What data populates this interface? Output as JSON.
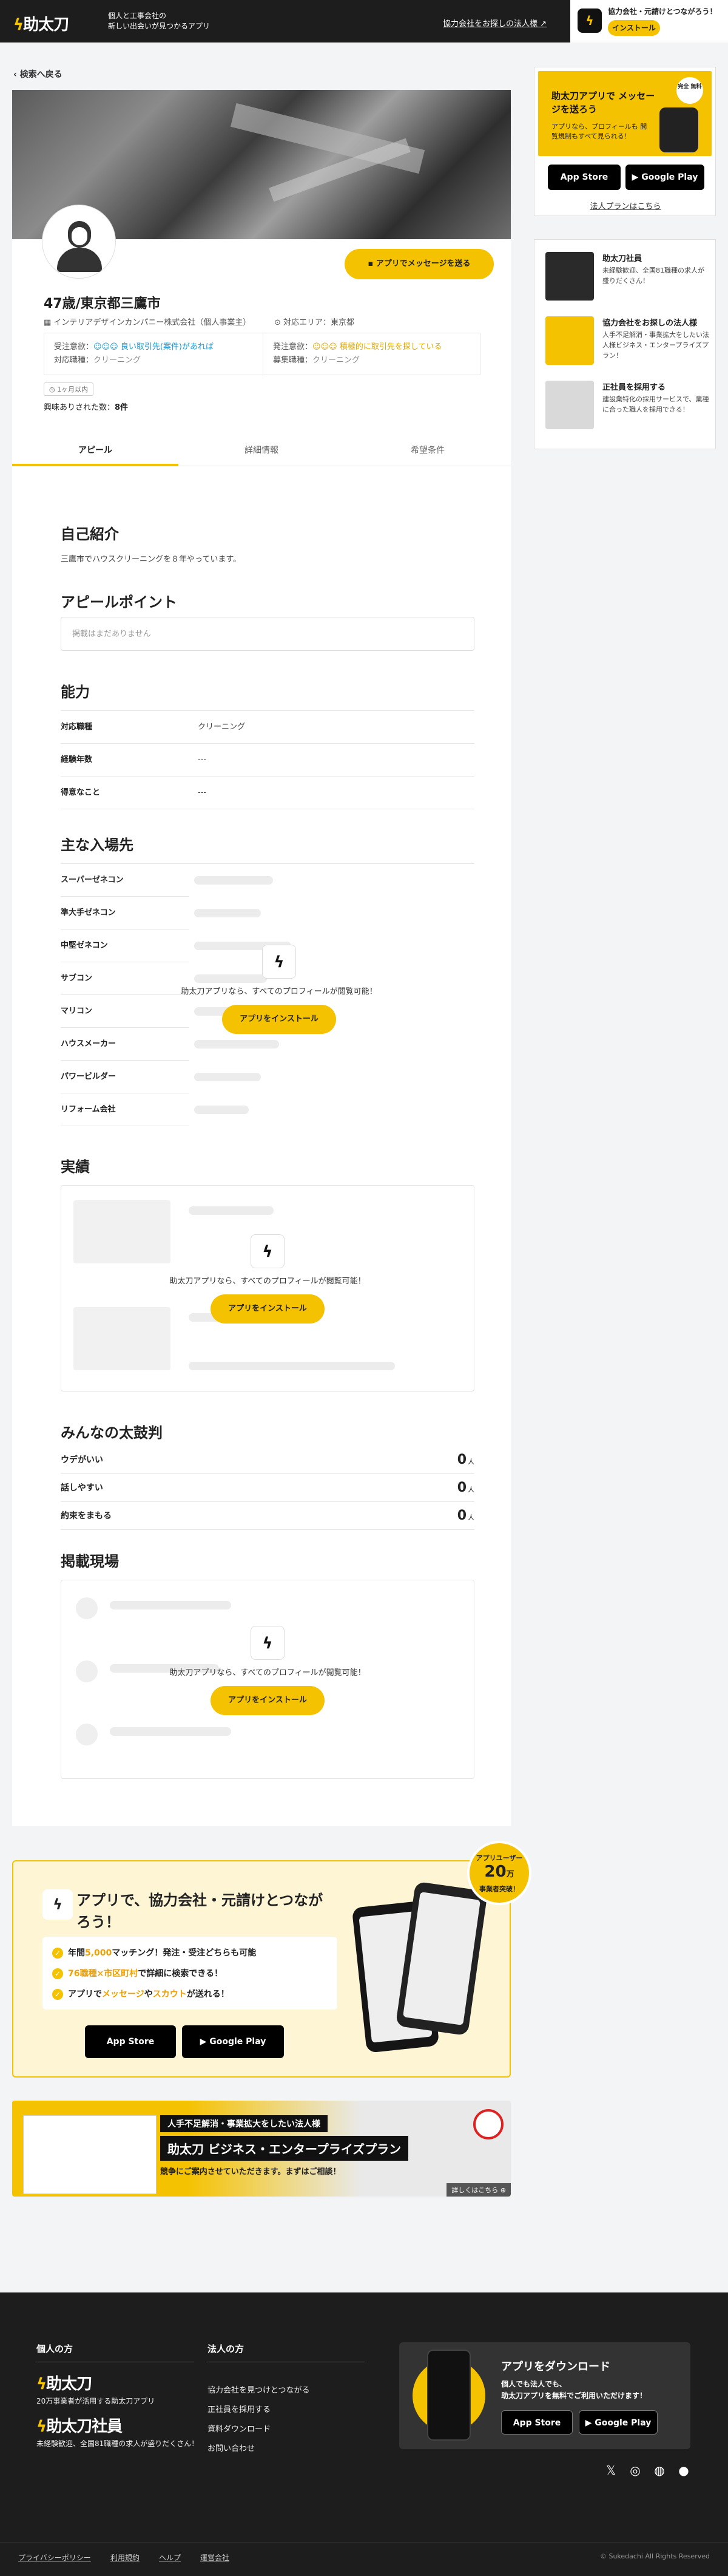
{
  "header": {
    "logo": "助太刀",
    "tagline_1": "個人と工事会社の",
    "tagline_2": "新しい出会いが見つかるアプリ",
    "partner_link": "協力会社をお探しの法人様 ↗",
    "install_title": "協力会社・元請けとつながろう！",
    "install_button": "インストール"
  },
  "back_label": "検索へ戻る",
  "profile": {
    "message_button": "アプリでメッセージを送る",
    "name": "47歳/東京都三鷹市",
    "company": "インテリアデザインカンパニー株式会社（個人事業主）",
    "area": "対応エリア：東京都",
    "order_receive_label": "受注意欲：",
    "order_receive_value": "良い取引先(案件)があれば",
    "job_types_label": "対応職種：",
    "job_types_value": "クリーニング",
    "order_place_label": "発注意欲：",
    "order_place_value": "積極的に取引先を探している",
    "recruit_label": "募集職種：",
    "recruit_value": "クリーニング",
    "badge": "1ヶ月以内",
    "views_label": "興味ありされた数：",
    "views_value": "8件"
  },
  "tabs": [
    "アピール",
    "詳細情報",
    "希望条件"
  ],
  "intro": {
    "heading": "自己紹介",
    "text": "三鷹市でハウスクリーニングを８年やっています。"
  },
  "appeal": {
    "heading": "アピールポイント",
    "empty": "掲載はまだありません"
  },
  "ability": {
    "heading": "能力",
    "rows": [
      {
        "k": "対応職種",
        "v": "クリーニング"
      },
      {
        "k": "経験年数",
        "v": "---"
      },
      {
        "k": "得意なこと",
        "v": "---"
      }
    ]
  },
  "clients": {
    "heading": "主な入場先",
    "items": [
      "スーパーゼネコン",
      "準大手ゼネコン",
      "中堅ゼネコン",
      "サブコン",
      "マリコン",
      "ハウスメーカー",
      "パワービルダー",
      "リフォーム会社"
    ]
  },
  "locked": {
    "mini_logo": "助太刀",
    "text": "助太刀アプリなら、すべてのプロフィールが閲覧可能！",
    "button": "アプリをインストール"
  },
  "works": {
    "heading": "実績"
  },
  "drums": {
    "heading": "みんなの太鼓判",
    "rows": [
      {
        "k": "ウデがいい",
        "v": "0",
        "u": "人"
      },
      {
        "k": "話しやすい",
        "v": "0",
        "u": "人"
      },
      {
        "k": "約束をまもる",
        "v": "0",
        "u": "人"
      }
    ]
  },
  "sites": {
    "heading": "掲載現場"
  },
  "sidebar": {
    "banner_title": "助太刀アプリで メッセージを送ろう",
    "banner_sub": "アプリなら、プロフィールも 閲覧規制もすべて見られる！",
    "banner_seal": "完全 無料",
    "app_store": "App Store",
    "google_play": "Google Play",
    "plan_link": "法人プランはこちら",
    "items": [
      {
        "title": "助太刀社員",
        "desc": "未経験歓迎、全国81職種の求人が盛りだくさん！",
        "thumb": "助太刀社員"
      },
      {
        "title": "協力会社をお探しの法人様",
        "desc": "人手不足解消・事業拡大をしたい法人様ビジネス・エンタープライズプラン！",
        "thumb": "助太刀"
      },
      {
        "title": "正社員を採用する",
        "desc": "建設業特化の採用サービスで、業種に合った職人を採用できる！",
        "thumb": "正社員"
      }
    ]
  },
  "promo": {
    "title": "アプリで、協力会社・元請けとつながろう！",
    "point1_a": "年間",
    "point1_b": "5,000",
    "point1_c": "マッチング！発注・受注どちらも可能",
    "point2_a": "76職種×市区町村",
    "point2_b": "で詳細に検索できる！",
    "point3_a": "アプリで",
    "point3_b": "メッセージ",
    "point3_c": "や",
    "point3_d": "スカウト",
    "point3_e": "が送れる！",
    "medal_a": "アプリユーザー",
    "medal_n": "20",
    "medal_unit": "万",
    "medal_b": "事業者突破！"
  },
  "enterprise": {
    "line1": "人手不足解消・事業拡大をしたい法人様",
    "line2": "助太刀 ビジネス・エンタープライズプラン",
    "line3": "競争にご案内させていただきます。まずはご相談！",
    "more": "詳しくはこちら ⊕"
  },
  "footer": {
    "personal_heading": "個人の方",
    "logo1": "助太刀",
    "logo1_desc": "20万事業者が活用する助太刀アプリ",
    "logo2": "助太刀社員",
    "logo2_desc": "未経験歓迎、全国81職種の求人が盛りだくさん！",
    "corp_heading": "法人の方",
    "corp_links": [
      "協力会社を見つけとつながる",
      "正社員を採用する",
      "資料ダウンロード",
      "お問い合わせ"
    ],
    "dl_title": "アプリをダウンロード",
    "dl_sub_1": "個人でも法人でも、",
    "dl_sub_2": "助太刀アプリを無料でご利用いただけます！",
    "bottom_links": [
      "プライバシーポリシー",
      "利用規約",
      "ヘルプ",
      "運営会社"
    ],
    "copyright": "© Sukedachi All Rights Reserved"
  }
}
